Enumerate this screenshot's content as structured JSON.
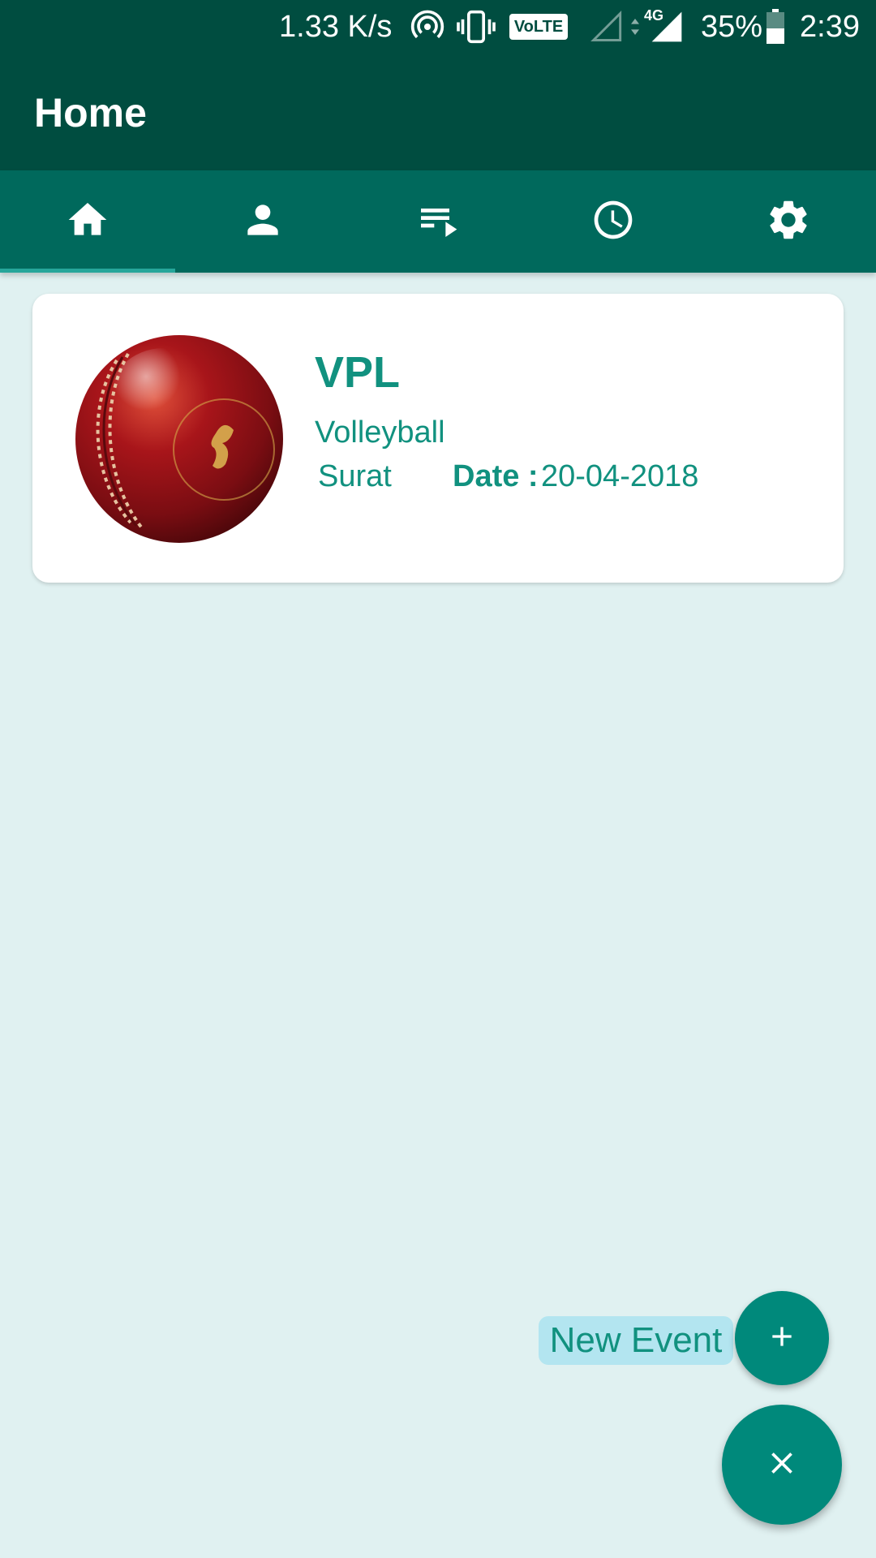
{
  "status_bar": {
    "network_speed": "1.33 K/s",
    "volte_label": "VoLTE",
    "network_type": "4G",
    "battery": "35%",
    "time": "2:39"
  },
  "app_bar": {
    "title": "Home"
  },
  "tabs": [
    {
      "icon": "home-icon",
      "selected": true
    },
    {
      "icon": "person-icon",
      "selected": false
    },
    {
      "icon": "playlist-icon",
      "selected": false
    },
    {
      "icon": "clock-icon",
      "selected": false
    },
    {
      "icon": "settings-icon",
      "selected": false
    }
  ],
  "events": [
    {
      "title": "VPL",
      "sport": "Volleyball",
      "city": "Surat",
      "date_label": "Date :",
      "date": "20-04-2018",
      "image_icon": "cricket-ball-image"
    }
  ],
  "fab": {
    "new_event_label": "New Event",
    "add_icon": "plus-icon",
    "close_icon": "close-icon"
  },
  "colors": {
    "app_bar": "#004d40",
    "tab_bar": "#00695c",
    "accent": "#00897b",
    "text_teal": "#11917f",
    "background": "#e0f1f1",
    "label_bg": "#b3e5f0"
  }
}
